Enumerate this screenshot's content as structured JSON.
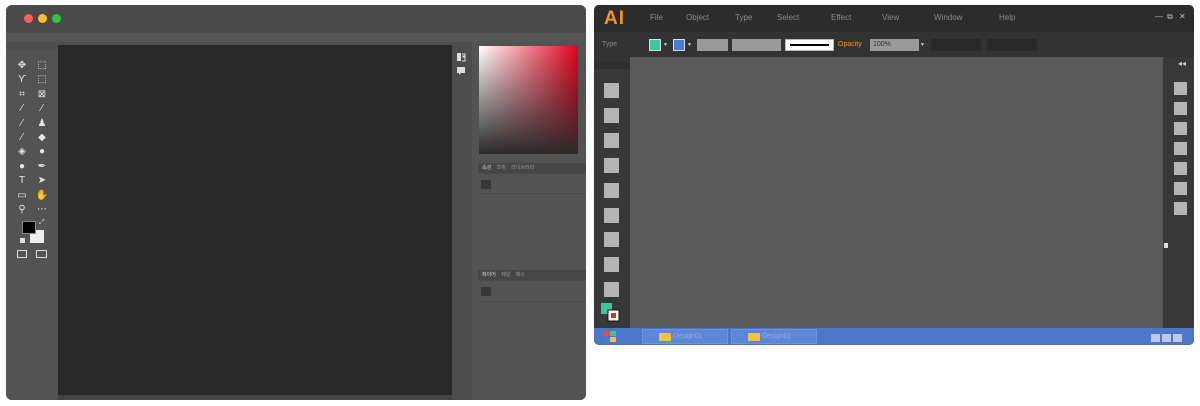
{
  "ps_window": {
    "traffic_lights": [
      {
        "name": "close",
        "color": "#ff5f57"
      },
      {
        "name": "minimize",
        "color": "#febc2e"
      },
      {
        "name": "zoom",
        "color": "#28c840"
      }
    ],
    "tools": [
      {
        "name": "move-tool-icon",
        "glyph": "✥"
      },
      {
        "name": "marquee-tool-icon",
        "glyph": "⬚"
      },
      {
        "name": "lasso-tool-icon",
        "glyph": "ϒ"
      },
      {
        "name": "quick-select-tool-icon",
        "glyph": "⬚"
      },
      {
        "name": "crop-tool-icon",
        "glyph": "⌗"
      },
      {
        "name": "frame-tool-icon",
        "glyph": "⊠"
      },
      {
        "name": "eyedropper-tool-icon",
        "glyph": "⁄"
      },
      {
        "name": "healing-brush-tool-icon",
        "glyph": "⁄"
      },
      {
        "name": "brush-tool-icon",
        "glyph": "⁄"
      },
      {
        "name": "stamp-tool-icon",
        "glyph": "♟"
      },
      {
        "name": "history-brush-tool-icon",
        "glyph": "⁄"
      },
      {
        "name": "eraser-tool-icon",
        "glyph": "◆"
      },
      {
        "name": "paint-bucket-tool-icon",
        "glyph": "◈"
      },
      {
        "name": "blur-tool-icon",
        "glyph": "●"
      },
      {
        "name": "dodge-tool-icon",
        "glyph": "●"
      },
      {
        "name": "pen-tool-icon",
        "glyph": "✒"
      },
      {
        "name": "type-tool-icon",
        "glyph": "T"
      },
      {
        "name": "path-select-tool-icon",
        "glyph": "➤"
      },
      {
        "name": "rectangle-tool-icon",
        "glyph": "▭"
      },
      {
        "name": "hand-tool-icon",
        "glyph": "✋"
      },
      {
        "name": "zoom-tool-icon",
        "glyph": "⚲"
      },
      {
        "name": "more-tools-icon",
        "glyph": "⋯"
      }
    ],
    "panel_tabs_1": [
      "속성",
      "조정",
      "라이브러리"
    ],
    "panel_tabs_2": [
      "레이어",
      "채널",
      "패스"
    ],
    "gradient_hue": "#e3001b"
  },
  "ai_window": {
    "logo": "AI",
    "menus": [
      "File",
      "Object",
      "Type",
      "Select",
      "Effect",
      "View",
      "Window",
      "Help"
    ],
    "control_bar": {
      "label": "Type",
      "fill_color": "#3ec6a0",
      "stroke_color": "#4a7bd3",
      "opacity_label": "Opacity",
      "opacity_value": "100%"
    },
    "window_controls": [
      "—",
      "⧉",
      "✕"
    ],
    "panel_collapse": "◂◂",
    "taskbar": {
      "tasks": [
        "Design01",
        "Design02"
      ]
    },
    "fill_swatch": "#3ec6a0",
    "start_colors": [
      "#e94b35",
      "#3ec6a0",
      "#4a7bd3",
      "#f5c242"
    ]
  }
}
